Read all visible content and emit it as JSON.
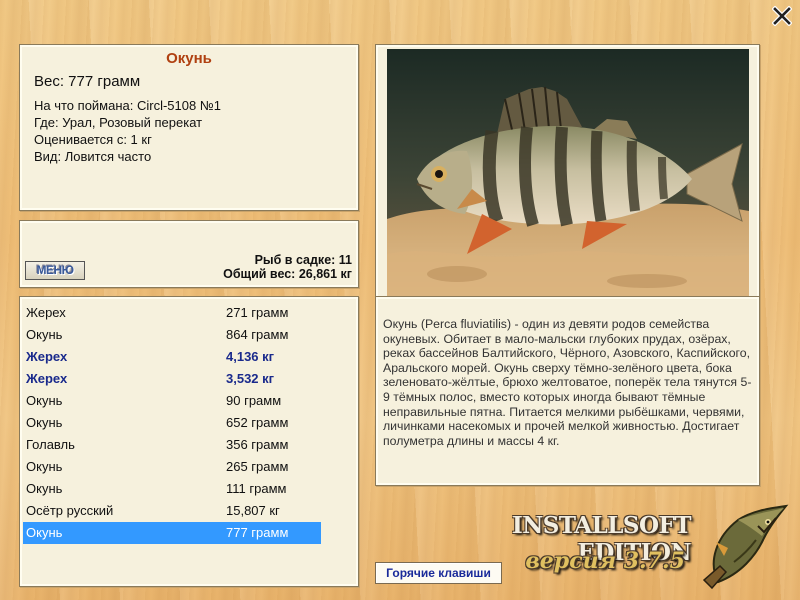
{
  "fish": {
    "title": "Окунь",
    "weight": "Вес: 777 грамм",
    "caught_with": "На что поймана: Circl-5108 №1",
    "location": "Где: Урал, Розовый перекат",
    "valued_from": "Оценивается с: 1 кг",
    "type": "Вид: Ловится часто"
  },
  "stats": {
    "menu_label": "МЕНЮ",
    "fish_in_cage": "Рыб в садке: 11",
    "total_weight": "Общий вес: 26,861 кг"
  },
  "catch_list": [
    {
      "name": "Жерех",
      "weight": "271 грамм",
      "big": false,
      "selected": false
    },
    {
      "name": "Окунь",
      "weight": "864 грамм",
      "big": false,
      "selected": false
    },
    {
      "name": "Жерех",
      "weight": "4,136 кг",
      "big": true,
      "selected": false
    },
    {
      "name": "Жерех",
      "weight": "3,532 кг",
      "big": true,
      "selected": false
    },
    {
      "name": "Окунь",
      "weight": "90 грамм",
      "big": false,
      "selected": false
    },
    {
      "name": "Окунь",
      "weight": "652 грамм",
      "big": false,
      "selected": false
    },
    {
      "name": "Голавль",
      "weight": "356 грамм",
      "big": false,
      "selected": false
    },
    {
      "name": "Окунь",
      "weight": "265 грамм",
      "big": false,
      "selected": false
    },
    {
      "name": "Окунь",
      "weight": "111 грамм",
      "big": false,
      "selected": false
    },
    {
      "name": "Осётр русский",
      "weight": "15,807 кг",
      "big": false,
      "selected": false
    },
    {
      "name": "Окунь",
      "weight": "777 грамм",
      "big": false,
      "selected": true
    }
  ],
  "description": "Окунь (Perca fluviatilis) - один из девяти родов семейства окуневых. Обитает в мало-мальски глубоких прудах, озёрах, реках бассейнов Балтийского, Чёрного, Азовского, Каспийского, Аральского морей. Окунь сверху тёмно-зелёного цвета, бока зеленовато-жёлтые, брюхо желтоватое, поперёк тела тянутся 5-9 тёмных полос, вместо которых иногда бывают тёмные неправильные пятна. Питается мелкими рыбёшками, червями, личинками насекомых и прочей мелкой живностью. Достигает полуметра длины и массы 4 кг.",
  "footer": {
    "hotkeys_label": "Горячие клавиши",
    "edition": "INSTALLSOFT EDITION",
    "version": "версия 3.7.5"
  },
  "icons": {
    "close": "close-icon",
    "photo": "perch-photo",
    "logo": "pike-logo"
  },
  "colors": {
    "title": "#b04010",
    "big_catch": "#1a2a8c",
    "selection": "#3399ff",
    "panel": "#f6f1dd"
  }
}
